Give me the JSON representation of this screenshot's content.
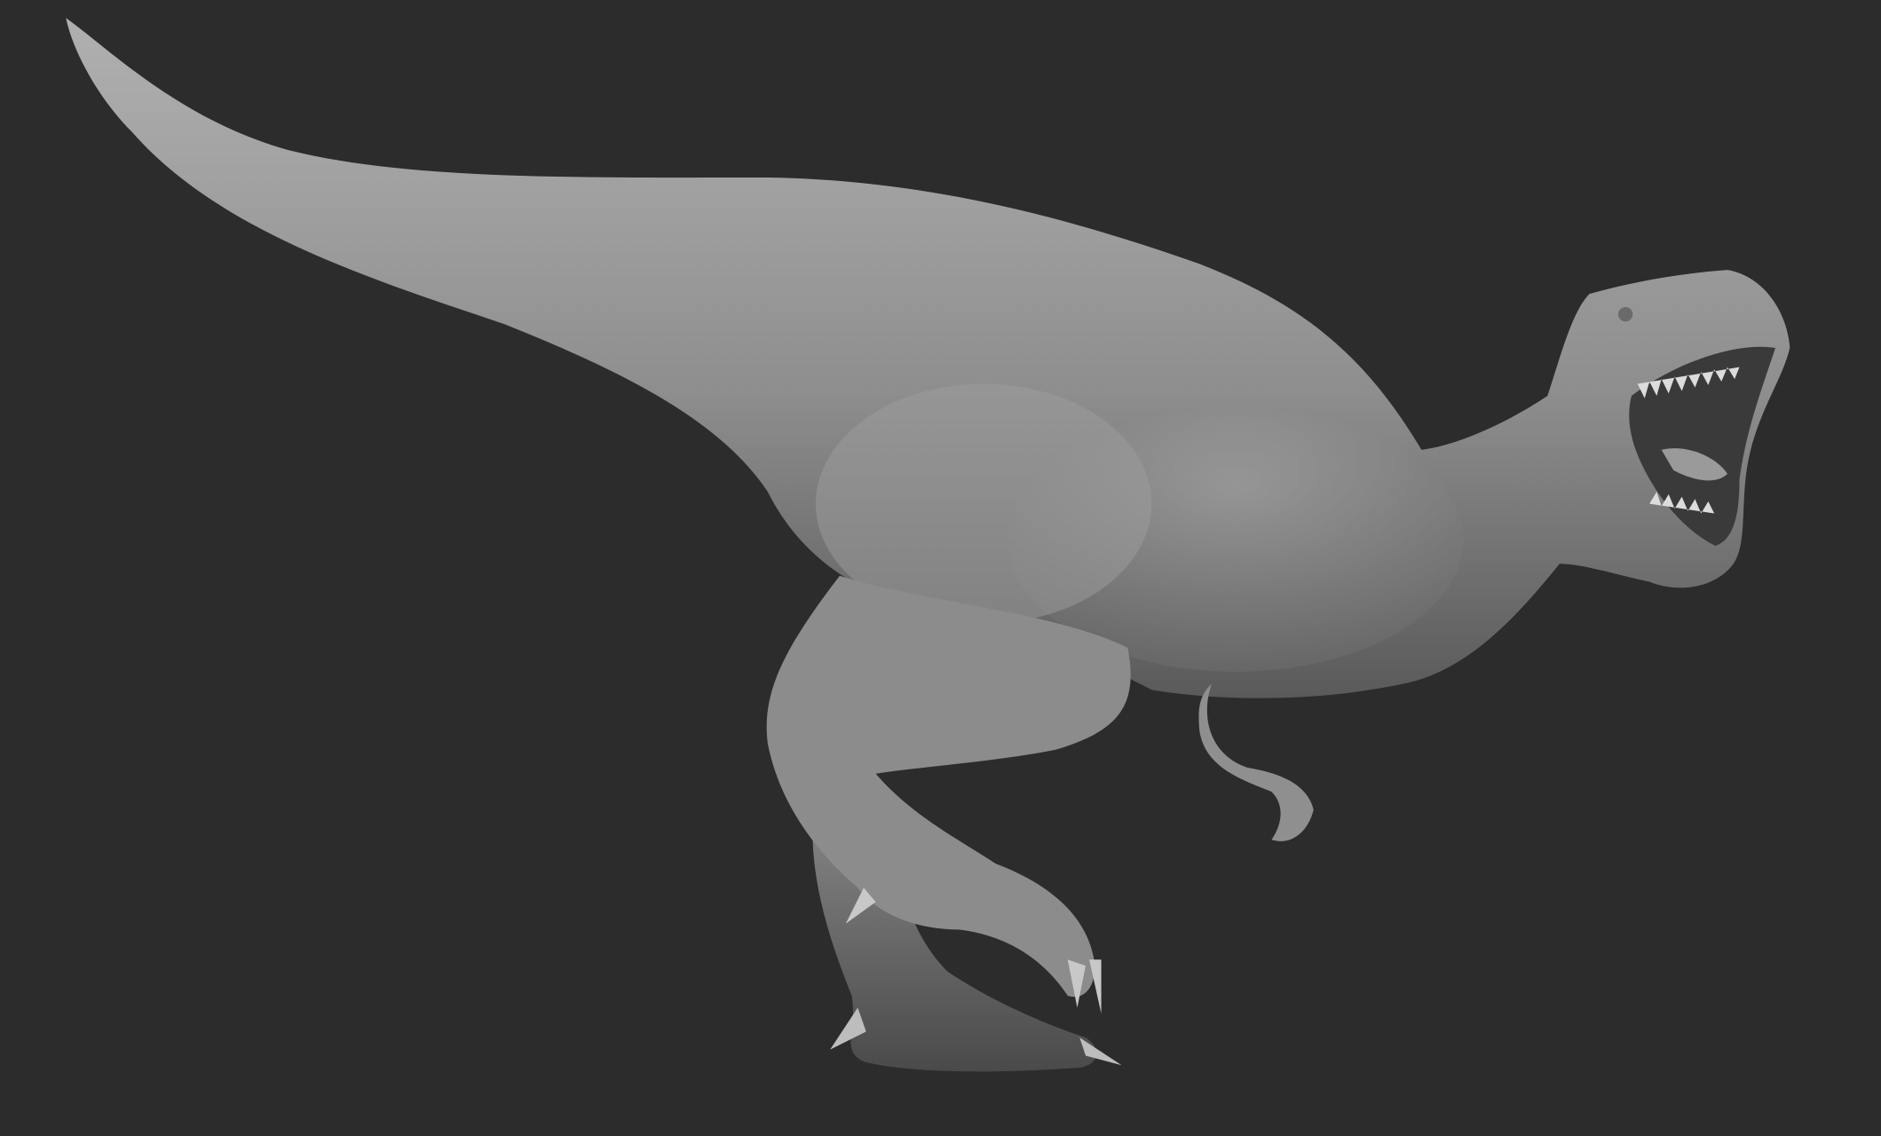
{
  "colors": {
    "background": "#2c2c2c",
    "body_light": "#a8a8a8",
    "body_mid": "#7e7e7e",
    "body_dark": "#4a4a4a",
    "mouth": "#3a3a3a",
    "teeth": "#d8d8d8"
  }
}
